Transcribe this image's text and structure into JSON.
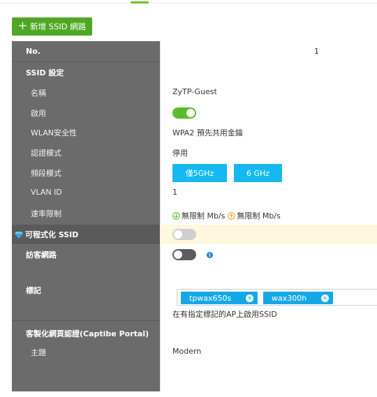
{
  "toolbar": {
    "add_ssid_label": "新增 SSID 網路"
  },
  "labels": {
    "no": "No.",
    "ssid_settings": "SSID 設定",
    "name": "名稱",
    "enable": "啟用",
    "wlan_security": "WLAN安全性",
    "auth_mode": "認證模式",
    "band_mode": "頻段模式",
    "vlan_id": "VLAN ID",
    "rate_limit": "速率限制",
    "programmable_ssid": "可程式化 SSID",
    "guest_network": "訪客網路",
    "tag": "標記",
    "captive_portal": "客製化網頁認證(Captibe Portal)",
    "theme": "主題"
  },
  "values": {
    "no": "1",
    "name": "ZyTP-Guest",
    "enable": true,
    "wlan_security": "WPA2 預先共用金鑰",
    "auth_mode": "停用",
    "band_buttons": [
      "僅5GHz",
      "6 GHz"
    ],
    "vlan_id": "1",
    "rate_down": "無限制 Mb/s",
    "rate_up": "無限制 Mb/s",
    "programmable_ssid": false,
    "guest_network": false,
    "tags": [
      "tpwax650s",
      "wax300h"
    ],
    "tag_note": "在有指定標記的AP上啟用SSID",
    "theme": "Modern"
  },
  "icons": {
    "add": "plus-icon",
    "premium": "diamond-icon",
    "download": "arrow-down-circle-icon",
    "upload": "arrow-up-circle-icon",
    "info": "info-icon",
    "remove_tag": "close-circle-icon"
  },
  "colors": {
    "primary_green": "#4fa823",
    "toggle_on": "#5bbb2a",
    "accent_blue": "#15b8f0",
    "label_panel": "#6b6b6b",
    "highlight": "#fff7de"
  }
}
